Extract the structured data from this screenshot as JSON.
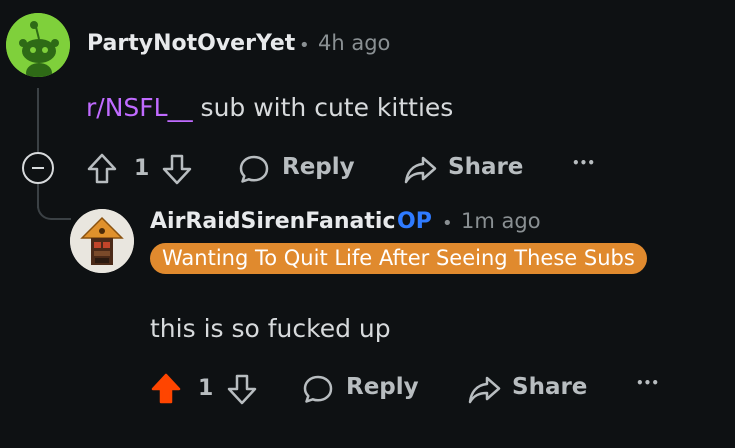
{
  "comments": [
    {
      "username": "PartyNotOverYet",
      "timestamp": "4h ago",
      "body_link": "r/NSFL__",
      "body_rest": " sub with cute kitties",
      "votes": "1",
      "vote_state": "none",
      "avatar_icon": "snoo-avatar-icon"
    },
    {
      "username": "AirRaidSirenFanatic",
      "op_tag": "OP",
      "timestamp": "1m ago",
      "flair": "Wanting To Quit Life After Seeing These Subs",
      "body": "this is so fucked up",
      "votes": "1",
      "vote_state": "upvoted",
      "avatar_icon": "siren-avatar-icon"
    }
  ],
  "actions": {
    "reply": "Reply",
    "share": "Share",
    "more": "•••"
  },
  "separator": "•",
  "colors": {
    "background": "#0e1113",
    "sublink": "#c06bff",
    "op": "#2f7bff",
    "flair_bg": "#e08a2e",
    "upvote_active": "#ff4500",
    "avatar1_bg": "#7fd03b"
  }
}
